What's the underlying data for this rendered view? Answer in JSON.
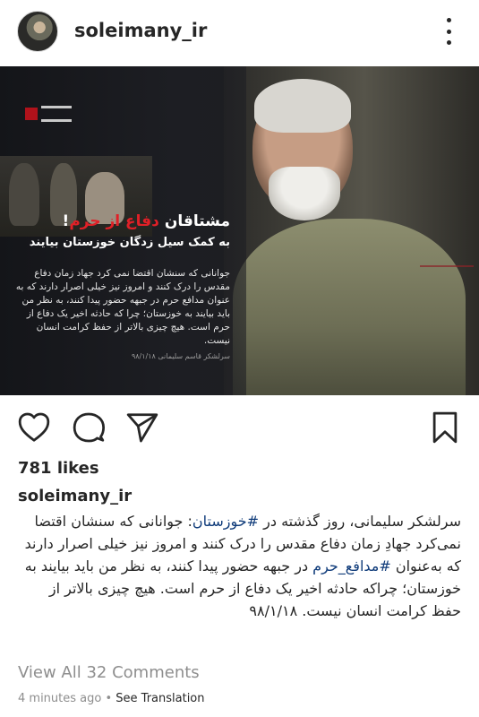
{
  "header": {
    "username": "soleimany_ir",
    "avatar_icon": "profile-avatar",
    "more_icon": "more-vertical-icon"
  },
  "image": {
    "headline_part1": "مشتاقان ",
    "headline_red": "دفاع از حرم",
    "headline_part2": "!",
    "subheadline": "به کمک سیل زدگان خوزستان بیایند",
    "quote": "جوانانی که سنشان اقتضا نمی کرد جهاد زمان دفاع مقدس را درک کنند و امروز نیز خیلی اصرار دارند که به عنوان مدافع حرم در جبهه حضور پیدا کنند، به نظر من باید بیایند به خوزستان؛ چرا که حادثه اخیر یک دفاع از حرم است. هیچ چیزی بالاتر از حفظ کرامت انسان نیست.",
    "signature": "سرلشکر قاسم سلیمانی ۹۸/۱/۱۸",
    "colors": {
      "accent_red": "#e02027"
    }
  },
  "actions": {
    "like_icon": "heart-icon",
    "comment_icon": "comment-icon",
    "share_icon": "send-icon",
    "save_icon": "bookmark-icon"
  },
  "likes": "781 likes",
  "caption": {
    "username": "soleimany_ir",
    "text_1": "سرلشکر سلیمانی، روز گذشته در ",
    "tag_1": "#خوزستان",
    "text_2": ": جوانانی که سنشان اقتضا نمی‌کرد جهادِ زمان دفاع مقدس را درک کنند و امروز نیز خیلی اصرار دارند که به‌عنوان ",
    "tag_2": "#مدافع_حرم",
    "text_3": " در جبهه حضور پیدا کنند، به نظر من باید بیایند به خوزستان؛ چراکه حادثه اخیر یک دفاع از حرم است. هیچ چیزی بالاتر از حفظ کرامت انسان نیست. ۹۸/۱/۱۸"
  },
  "comments_link": "View All 32 Comments",
  "meta": {
    "time": "4 minutes ago",
    "separator": " • ",
    "see_translation": "See Translation"
  }
}
